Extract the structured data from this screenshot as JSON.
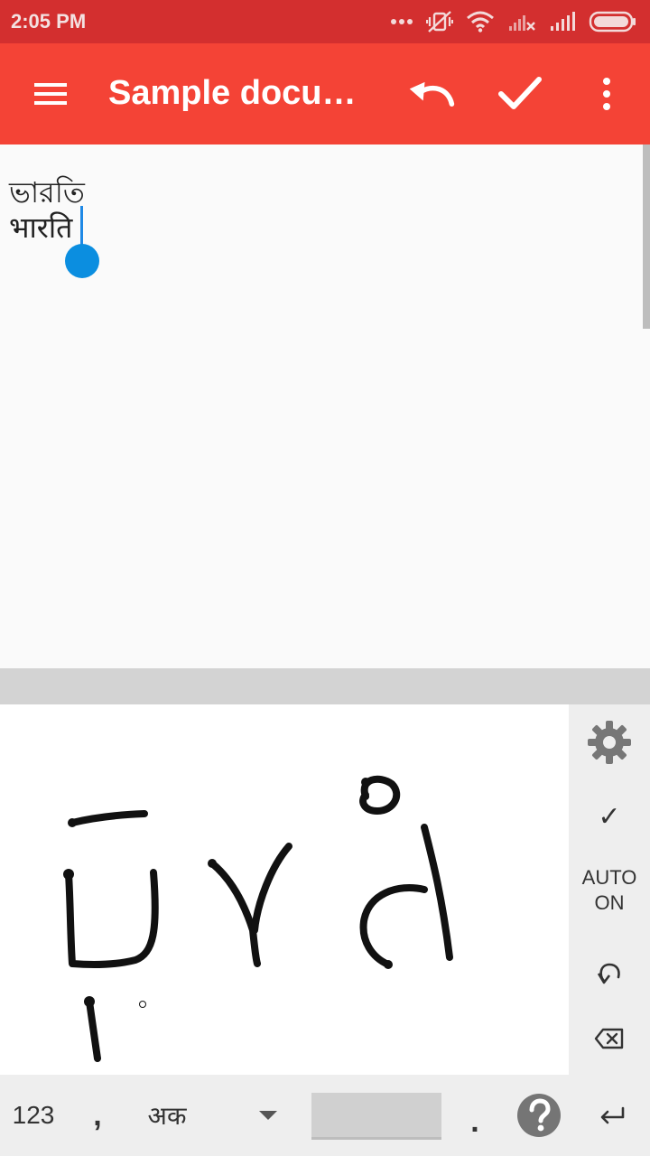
{
  "status_bar": {
    "time": "2:05 PM",
    "icons": [
      "more-dots-icon",
      "vibrate-off-icon",
      "wifi-icon",
      "signal-x-icon",
      "signal-icon",
      "battery-icon"
    ]
  },
  "app_bar": {
    "title": "Sample docum…",
    "icons": [
      "menu-icon",
      "undo-icon",
      "check-icon",
      "more-vert-icon"
    ],
    "color": "#f44336"
  },
  "document": {
    "lines": [
      "ভারতি",
      "भारति"
    ],
    "caret_color": "#1e88e5"
  },
  "handwriting_panel": {
    "side_actions": {
      "settings": "gear-icon",
      "accept": "✓",
      "auto_label_1": "AUTO",
      "auto_label_2": "ON",
      "undo": "undo-small-icon",
      "backspace": "backspace-icon"
    }
  },
  "keyboard": {
    "numbers_label": "123",
    "comma_label": ",",
    "lang_label": "अक",
    "period_label": ".",
    "icons": [
      "dropdown-arrow-icon",
      "help-icon",
      "enter-icon"
    ]
  }
}
